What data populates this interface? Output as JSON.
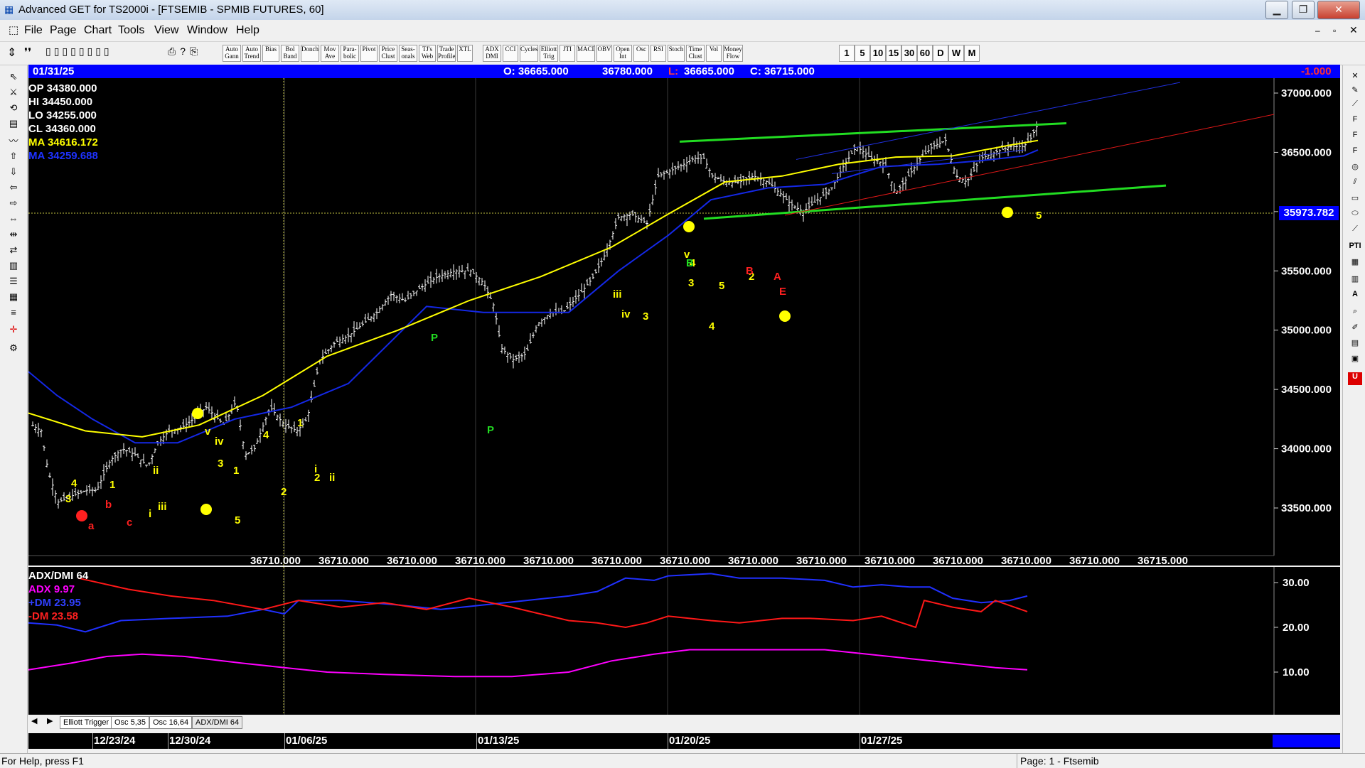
{
  "window": {
    "title": "Advanced GET for TS2000i - [FTSEMIB - SPMIB FUTURES, 60]",
    "minimize": "▁",
    "restore": "❐",
    "close": "✕"
  },
  "menu": [
    "File",
    "Page",
    "Chart",
    "Tools",
    "View",
    "Window",
    "Help"
  ],
  "toolbar": {
    "study_buttons": [
      "Auto Gann",
      "Auto Trend",
      "Bias",
      "Bol Band",
      "Donch",
      "Mov Ave",
      "Para-bolic",
      "Pivot",
      "Price Clust",
      "Seas-onals",
      "TJ's Web",
      "Trade Profile",
      "XTL",
      "ADX DMI",
      "CCI",
      "Cycles",
      "Elliott Trig",
      "JTI",
      "MACD",
      "OBV",
      "Open Int",
      "Osc",
      "RSI",
      "Stoch",
      "Time Clust",
      "Vol",
      "Money Flow"
    ],
    "intervals": [
      "1",
      "5",
      "10",
      "15",
      "30",
      "60",
      "D",
      "W",
      "M"
    ]
  },
  "ohlc_bar": {
    "date": "01/31/25",
    "open": "O: 36665.000",
    "high": "36780.000",
    "low_label": "L:",
    "low": "36665.000",
    "close": "C: 36715.000",
    "change": "-1.000"
  },
  "legend": {
    "op": "OP  34380.000",
    "hi": "HI   34450.000",
    "lo": "LO  34255.000",
    "cl": "CL  34360.000",
    "ma1": "MA  34616.172",
    "ma2": "MA  34259.688"
  },
  "price_axis": [
    "37000.000",
    "36500.000",
    "36000.000",
    "35500.000",
    "35000.000",
    "34500.000",
    "34000.000",
    "33500.000"
  ],
  "cursor_price": "35973.782",
  "bottom_values": [
    "36710.000",
    "36710.000",
    "36710.000",
    "36710.000",
    "36710.000",
    "36710.000",
    "36710.000",
    "36710.000",
    "36710.000",
    "36710.000",
    "36710.000",
    "36710.000",
    "36710.000",
    "36715.000"
  ],
  "wave_labels": {
    "yellow": [
      "4",
      "3",
      "1",
      "i",
      "ii",
      "iii",
      "v",
      "iv",
      "3",
      "1",
      "5",
      "4",
      "2",
      "1",
      "2",
      "i",
      "ii",
      "iii",
      "iv",
      "3",
      "v",
      "4",
      "3",
      "4",
      "5",
      "5",
      "2"
    ],
    "red": [
      "b",
      "a",
      "c",
      "B",
      "A",
      "C",
      "E"
    ],
    "green": [
      "P",
      "P",
      "B"
    ]
  },
  "adx": {
    "title": "ADX/DMI 64",
    "adx": "ADX 9.97",
    "plus_dm": "+DM 23.95",
    "minus_dm": "-DM  23.58",
    "axis": [
      "30.00",
      "20.00",
      "10.00"
    ]
  },
  "tabs": [
    "Elliott Trigger",
    "Osc 5,35",
    "Osc 16,64",
    "ADX/DMI 64"
  ],
  "dates": [
    "12/23/24",
    "12/30/24",
    "01/06/25",
    "01/13/25",
    "01/20/25",
    "01/27/25"
  ],
  "status": {
    "left": "For Help, press F1",
    "right": "Page: 1 - Ftsemib"
  },
  "colors": {
    "chart_bg": "#000000",
    "bar_blue": "#0000ff",
    "ma_yellow": "#ffff00",
    "ma_blue": "#1428e6",
    "channel_green": "#22dd22",
    "trend_red": "#e01818",
    "adx_magenta": "#ff00ff"
  },
  "chart_data": {
    "type": "line",
    "title": "FTSEMIB - SPMIB FUTURES, 60",
    "ylim": [
      33300,
      37100
    ],
    "x": [
      "12/23/24",
      "12/30/24",
      "01/06/25",
      "01/13/25",
      "01/20/25",
      "01/27/25",
      "01/31/25"
    ],
    "series": [
      {
        "name": "",
        "values": [
          33600,
          34150,
          34400,
          35400,
          36500,
          36450,
          36715
        ]
      }
    ]
  }
}
